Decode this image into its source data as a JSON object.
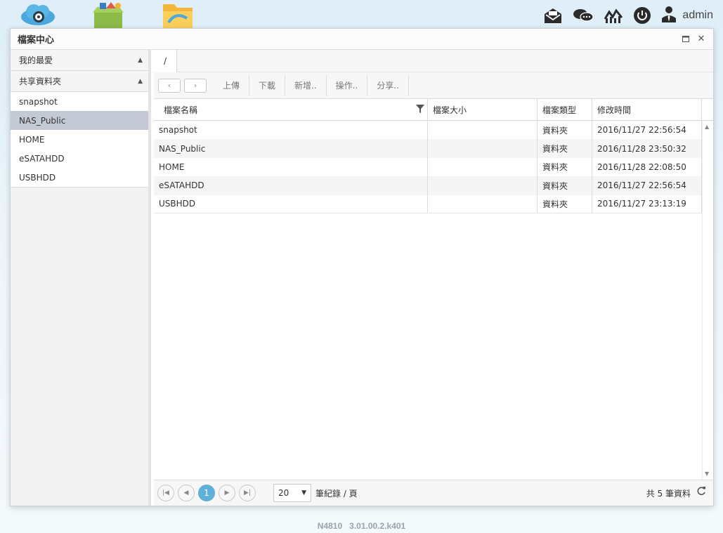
{
  "window": {
    "title": "檔案中心"
  },
  "sidebar": {
    "favorites_header": "我的最愛",
    "shared_header": "共享資料夾",
    "items": [
      {
        "label": "snapshot"
      },
      {
        "label": "NAS_Public"
      },
      {
        "label": "HOME"
      },
      {
        "label": "eSATAHDD"
      },
      {
        "label": "USBHDD"
      }
    ],
    "selected": "NAS_Public"
  },
  "path": {
    "current": "/"
  },
  "toolbar": {
    "upload_label": "上傳",
    "download_label": "下載",
    "new_label": "新增..",
    "actions_label": "操作..",
    "share_label": "分享.."
  },
  "grid": {
    "columns": {
      "name": "檔案名稱",
      "size": "檔案大小",
      "type": "檔案類型",
      "modified": "修改時間"
    },
    "rows": [
      {
        "name": "snapshot",
        "size": "",
        "type": "資料夾",
        "modified": "2016/11/27 22:56:54"
      },
      {
        "name": "NAS_Public",
        "size": "",
        "type": "資料夾",
        "modified": "2016/11/28 23:50:32"
      },
      {
        "name": "HOME",
        "size": "",
        "type": "資料夾",
        "modified": "2016/11/28 22:08:50"
      },
      {
        "name": "eSATAHDD",
        "size": "",
        "type": "資料夾",
        "modified": "2016/11/27 22:56:54"
      },
      {
        "name": "USBHDD",
        "size": "",
        "type": "資料夾",
        "modified": "2016/11/27 23:13:19"
      }
    ]
  },
  "pager": {
    "current_page": "1",
    "page_size": "20",
    "per_page_label": "筆紀錄 / 頁",
    "total_label": "共 5 筆資料"
  },
  "topbar": {
    "user": "admin"
  },
  "footer": {
    "version": "N4810   3.01.00.2.k401"
  },
  "colors": {
    "selected_row": "#c4cad5",
    "active_page": "#5fb1d9"
  }
}
